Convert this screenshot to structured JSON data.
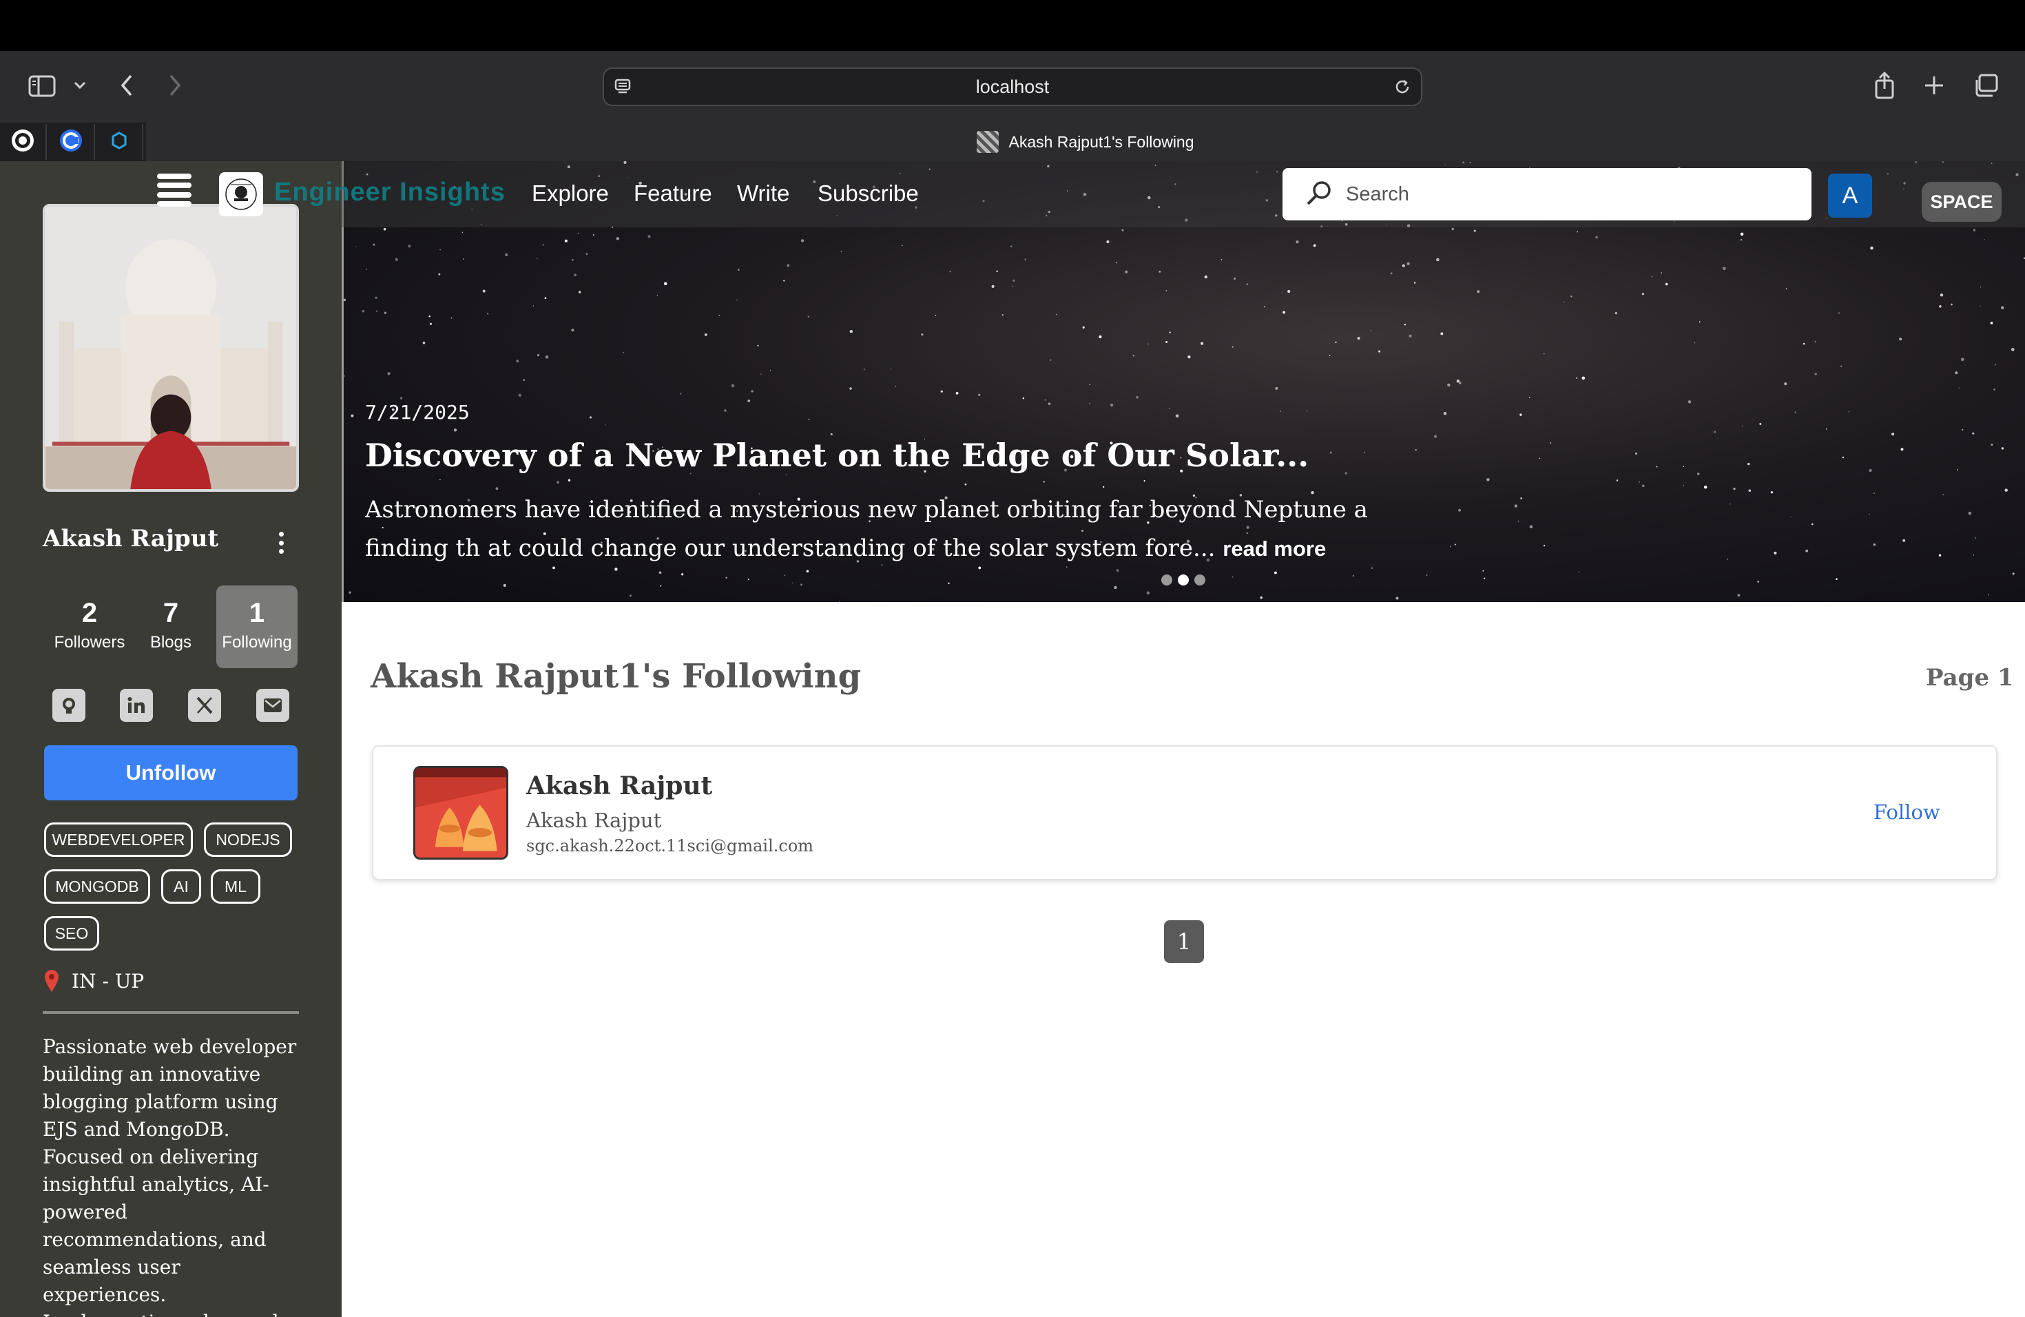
{
  "browser": {
    "url": "localhost",
    "tab_title": "Akash Rajput1's Following"
  },
  "navbar": {
    "site_name": "Engineer Insights",
    "links": [
      "Explore",
      "Feature",
      "Write",
      "Subscribe"
    ],
    "search_placeholder": "Search",
    "avatar_letter": "A",
    "space_label": "SPACE"
  },
  "hero": {
    "date": "7/21/2025",
    "title": "Discovery of a New Planet on the Edge of Our Solar...",
    "description": "Astronomers have identified a mysterious new planet orbiting far beyond Neptune a finding th at could change our understanding of the solar system fore...",
    "read_more": "read more",
    "slide_count": 3,
    "active_slide": 2
  },
  "profile": {
    "name": "Akash Rajput",
    "stats": [
      {
        "value": "2",
        "label": "Followers"
      },
      {
        "value": "7",
        "label": "Blogs"
      },
      {
        "value": "1",
        "label": "Following"
      }
    ],
    "social_icons": [
      "github-icon",
      "linkedin-icon",
      "x-icon",
      "mail-icon"
    ],
    "unfollow_label": "Unfollow",
    "tags": [
      "WEBDEVELOPER",
      "NODEJS",
      "MONGODB",
      "AI",
      "ML",
      "SEO"
    ],
    "location": "IN - UP",
    "bio": "Passionate web developer building an innovative blogging platform using EJS and MongoDB. Focused on delivering insightful analytics, AI-powered recommendations, and seamless user experiences. Implementing advanced features like content"
  },
  "main": {
    "heading": "Akash Rajput1's Following",
    "page_label": "Page 1",
    "following": [
      {
        "name": "Akash Rajput",
        "username": "Akash Rajput",
        "email": "sgc.akash.22oct.11sci@gmail.com",
        "action": "Follow"
      }
    ],
    "pagination": [
      "1"
    ]
  },
  "colors": {
    "sidebar_bg": "#3a3b35",
    "unfollow_blue": "#3b82f6",
    "follow_link": "#2f6fd6",
    "avatar_blue": "#0b5cad",
    "brand_teal": "#0f7f86"
  }
}
